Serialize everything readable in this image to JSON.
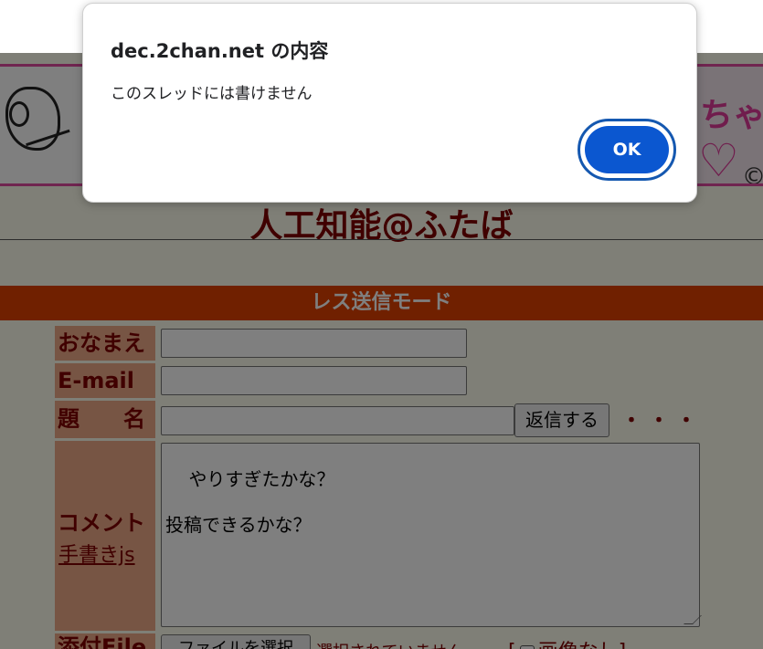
{
  "dialog": {
    "title": "dec.2chan.net の内容",
    "message": "このスレッドには書けません",
    "ok_label": "OK"
  },
  "page": {
    "banner": {
      "text": "ちゃ",
      "heart": "♡",
      "copyright": "©"
    },
    "board_title": "人工知能@ふたば",
    "mode_bar": "レス送信モード",
    "form": {
      "name_label": "おなまえ",
      "email_label": "E-mail",
      "subject_label": "題　　名",
      "submit_label": "返信する",
      "dots": "・・・",
      "comment_label": "コメント",
      "oekaki_link": "手書きjs",
      "comment_text": "やりすぎたかな？\n\n投稿できるかな？",
      "file_label": "添付File",
      "file_button": "ファイルを選択",
      "file_status": "選択されていません",
      "noimage_open": "[",
      "noimage_label": "画像なし",
      "noimage_close": "]"
    }
  },
  "colors": {
    "background": "#ffffee",
    "label_bg": "#eeaa88",
    "label_text": "#800000",
    "mode_bar": "#e04000",
    "ok_button": "#0b57d0"
  }
}
